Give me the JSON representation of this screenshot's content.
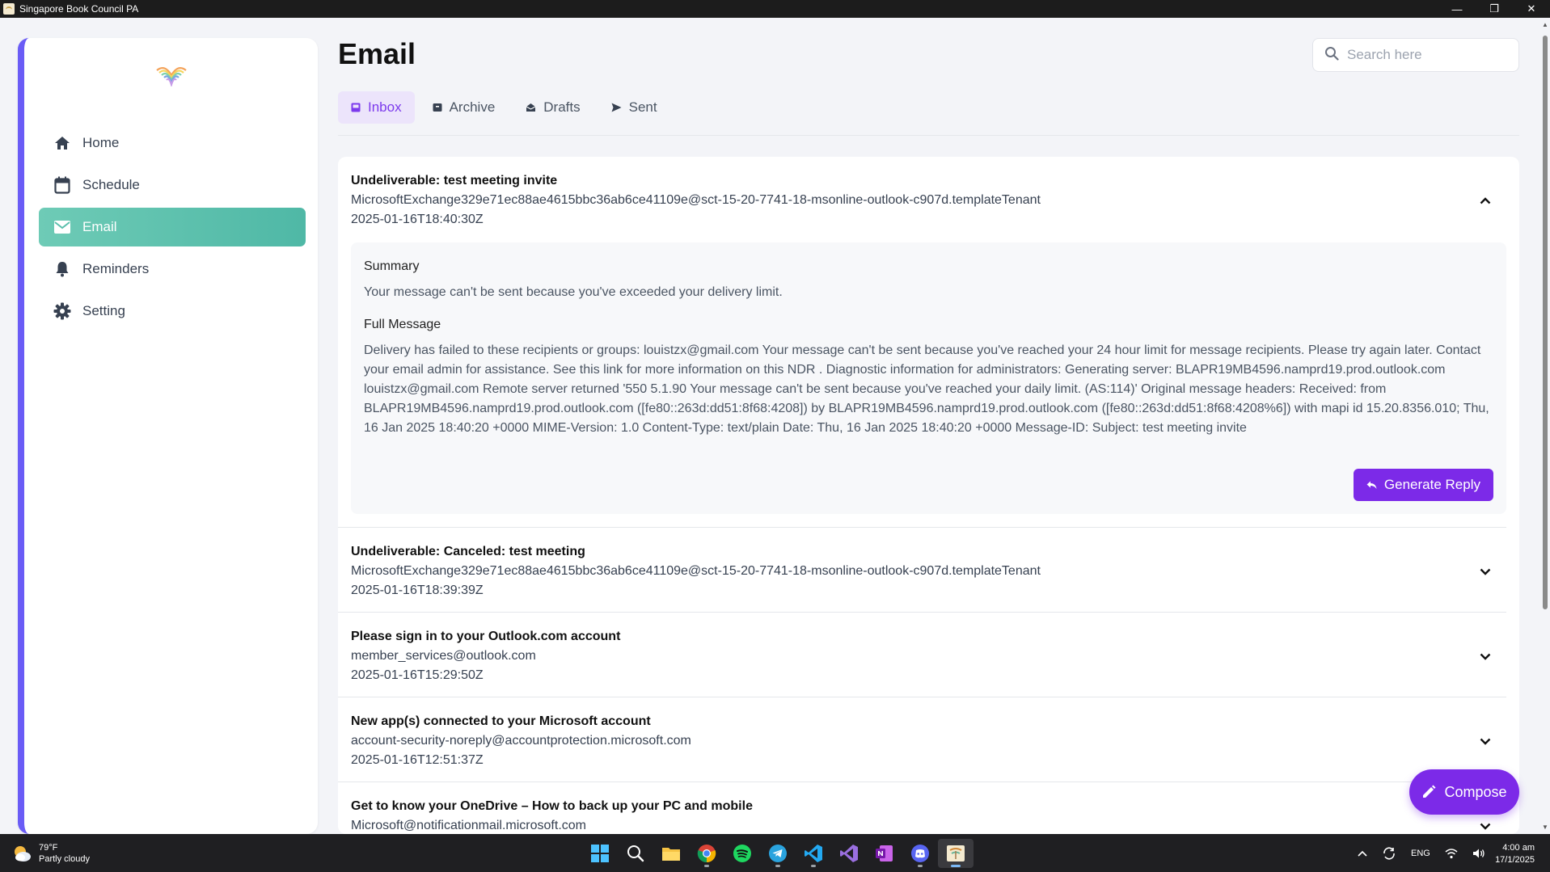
{
  "window": {
    "title": "Singapore Book Council PA"
  },
  "sidebar": {
    "items": [
      {
        "label": "Home",
        "icon": "home-icon",
        "active": false
      },
      {
        "label": "Schedule",
        "icon": "calendar-icon",
        "active": false
      },
      {
        "label": "Email",
        "icon": "mail-icon",
        "active": true
      },
      {
        "label": "Reminders",
        "icon": "bell-icon",
        "active": false
      },
      {
        "label": "Setting",
        "icon": "gear-icon",
        "active": false
      }
    ]
  },
  "header": {
    "title": "Email",
    "search_placeholder": "Search here"
  },
  "tabs": [
    {
      "label": "Inbox",
      "icon": "inbox-icon",
      "active": true
    },
    {
      "label": "Archive",
      "icon": "archive-icon",
      "active": false
    },
    {
      "label": "Drafts",
      "icon": "drafts-icon",
      "active": false
    },
    {
      "label": "Sent",
      "icon": "send-icon",
      "active": false
    }
  ],
  "emails": [
    {
      "subject": "Undeliverable: test meeting invite",
      "sender": "MicrosoftExchange329e71ec88ae4615bbc36ab6ce41109e@sct-15-20-7741-18-msonline-outlook-c907d.templateTenant",
      "date": "2025-01-16T18:40:30Z",
      "expanded": true,
      "summary_heading": "Summary",
      "summary": "Your message can't be sent because you've exceeded your delivery limit.",
      "full_heading": "Full Message",
      "full_message": "Delivery has failed to these recipients or groups: louistzx@gmail.com Your message can't be sent because you've reached your 24 hour limit for message recipients. Please try again later. Contact your email admin for assistance. See this link for more information on this NDR . Diagnostic information for administrators: Generating server: BLAPR19MB4596.namprd19.prod.outlook.com louistzx@gmail.com Remote server returned '550 5.1.90 Your message can't be sent because you've reached your daily limit. (AS:114)' Original message headers: Received: from BLAPR19MB4596.namprd19.prod.outlook.com ([fe80::263d:dd51:8f68:4208]) by BLAPR19MB4596.namprd19.prod.outlook.com ([fe80::263d:dd51:8f68:4208%6]) with mapi id 15.20.8356.010; Thu, 16 Jan 2025 18:40:20 +0000 MIME-Version: 1.0 Content-Type: text/plain Date: Thu, 16 Jan 2025 18:40:20 +0000 Message-ID: Subject: test meeting invite",
      "reply_label": "Generate Reply"
    },
    {
      "subject": "Undeliverable: Canceled: test meeting",
      "sender": "MicrosoftExchange329e71ec88ae4615bbc36ab6ce41109e@sct-15-20-7741-18-msonline-outlook-c907d.templateTenant",
      "date": "2025-01-16T18:39:39Z",
      "expanded": false
    },
    {
      "subject": "Please sign in to your Outlook.com account",
      "sender": "member_services@outlook.com",
      "date": "2025-01-16T15:29:50Z",
      "expanded": false
    },
    {
      "subject": "New app(s) connected to your Microsoft account",
      "sender": "account-security-noreply@accountprotection.microsoft.com",
      "date": "2025-01-16T12:51:37Z",
      "expanded": false
    },
    {
      "subject": "Get to know your OneDrive – How to back up your PC and mobile",
      "sender": "Microsoft@notificationmail.microsoft.com",
      "date": "",
      "expanded": false
    }
  ],
  "compose": {
    "label": "Compose"
  },
  "taskbar": {
    "weather_temp": "79°F",
    "weather_desc": "Partly cloudy",
    "language": "ENG",
    "time": "4:00 am",
    "date": "17/1/2025"
  },
  "colors": {
    "accent": "#7c2ae8",
    "sidebar_active": "#5abfac",
    "sidebar_border": "#6a5cf6",
    "tab_active_bg": "#ece4fb"
  }
}
